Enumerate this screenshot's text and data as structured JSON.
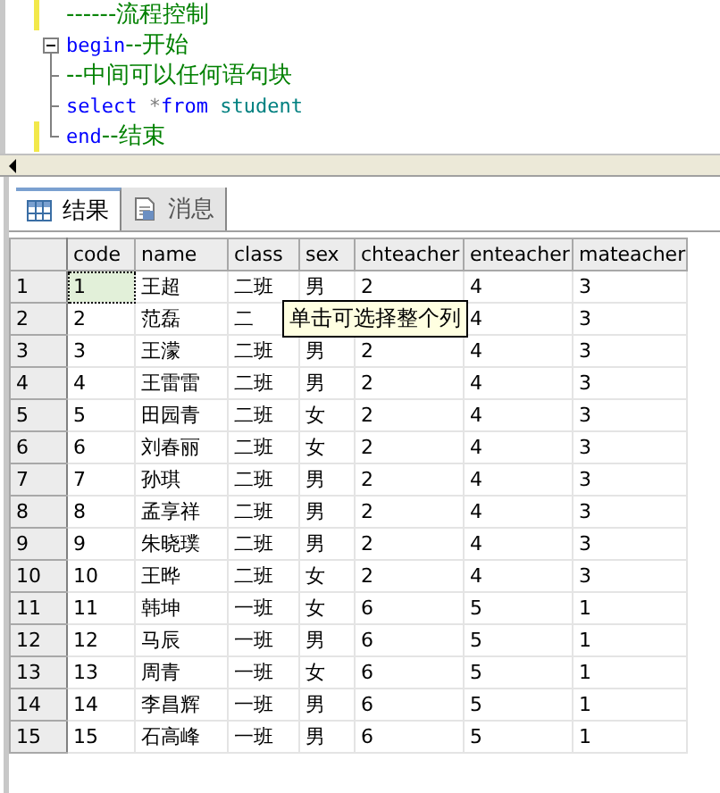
{
  "editor": {
    "lines": [
      {
        "changed": true,
        "kind": "plain",
        "tokens": [
          {
            "kind": "comment",
            "text": "------流程控制"
          }
        ]
      },
      {
        "changed": false,
        "kind": "fold_start",
        "tokens": [
          {
            "kind": "keyword",
            "text": "begin"
          },
          {
            "kind": "comment",
            "text": "--开始"
          }
        ]
      },
      {
        "changed": false,
        "kind": "fold_middle",
        "tokens": [
          {
            "kind": "comment",
            "text": "--中间可以任何语句块"
          }
        ]
      },
      {
        "changed": false,
        "kind": "fold_middle",
        "tokens": [
          {
            "kind": "keyword",
            "text": "select"
          },
          {
            "kind": "operator",
            "text": " *"
          },
          {
            "kind": "keyword",
            "text": "from"
          },
          {
            "kind": "identifier",
            "text": " student"
          }
        ]
      },
      {
        "changed": true,
        "kind": "fold_end",
        "tokens": [
          {
            "kind": "keyword",
            "text": "end"
          },
          {
            "kind": "comment",
            "text": "--结束"
          }
        ]
      }
    ]
  },
  "tabs": [
    {
      "label": "结果",
      "kind": "grid",
      "selected": true
    },
    {
      "label": "消息",
      "kind": "messages",
      "selected": false
    }
  ],
  "grid": {
    "columns": [
      "code",
      "name",
      "class",
      "sex",
      "chteacher",
      "enteacher",
      "mateacher"
    ],
    "rows": [
      {
        "header": "1",
        "focused": true,
        "cells": [
          "1",
          "王超",
          "二班",
          "男",
          "2",
          "4",
          "3"
        ]
      },
      {
        "header": "2",
        "focused": false,
        "cells": [
          "2",
          "范磊",
          "二",
          null,
          null,
          "4",
          "3"
        ]
      },
      {
        "header": "3",
        "focused": false,
        "cells": [
          "3",
          "王濛",
          "二班",
          "男",
          "2",
          "4",
          "3"
        ]
      },
      {
        "header": "4",
        "focused": false,
        "cells": [
          "4",
          "王雷雷",
          "二班",
          "男",
          "2",
          "4",
          "3"
        ]
      },
      {
        "header": "5",
        "focused": false,
        "cells": [
          "5",
          "田园青",
          "二班",
          "女",
          "2",
          "4",
          "3"
        ]
      },
      {
        "header": "6",
        "focused": false,
        "cells": [
          "6",
          "刘春丽",
          "二班",
          "女",
          "2",
          "4",
          "3"
        ]
      },
      {
        "header": "7",
        "focused": false,
        "cells": [
          "7",
          "孙琪",
          "二班",
          "男",
          "2",
          "4",
          "3"
        ]
      },
      {
        "header": "8",
        "focused": false,
        "cells": [
          "8",
          "孟享祥",
          "二班",
          "男",
          "2",
          "4",
          "3"
        ]
      },
      {
        "header": "9",
        "focused": false,
        "cells": [
          "9",
          "朱晓璞",
          "二班",
          "男",
          "2",
          "4",
          "3"
        ]
      },
      {
        "header": "10",
        "focused": false,
        "cells": [
          "10",
          "王晔",
          "二班",
          "女",
          "2",
          "4",
          "3"
        ]
      },
      {
        "header": "11",
        "focused": false,
        "cells": [
          "11",
          "韩坤",
          "一班",
          "女",
          "6",
          "5",
          "1"
        ]
      },
      {
        "header": "12",
        "focused": false,
        "cells": [
          "12",
          "马辰",
          "一班",
          "男",
          "6",
          "5",
          "1"
        ]
      },
      {
        "header": "13",
        "focused": false,
        "cells": [
          "13",
          "周青",
          "一班",
          "女",
          "6",
          "5",
          "1"
        ]
      },
      {
        "header": "14",
        "focused": false,
        "cells": [
          "14",
          "李昌辉",
          "一班",
          "男",
          "6",
          "5",
          "1"
        ]
      },
      {
        "header": "15",
        "focused": false,
        "cells": [
          "15",
          "石高峰",
          "一班",
          "男",
          "6",
          "5",
          "1"
        ]
      }
    ]
  },
  "tooltip": "单击可选择整个列"
}
